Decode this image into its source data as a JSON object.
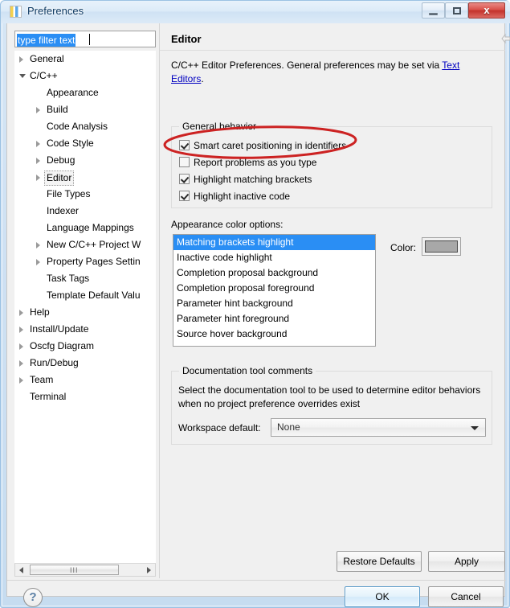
{
  "window": {
    "title": "Preferences",
    "icon": "preferences-icon",
    "buttons": {
      "minimize": "minimize-icon",
      "maximize": "maximize-icon",
      "close": "x"
    }
  },
  "filter": {
    "value": "type filter text",
    "placeholder": "type filter text"
  },
  "tree": {
    "items": [
      {
        "label": "General",
        "level": 1,
        "arrow": "collapsed",
        "focused": false
      },
      {
        "label": "C/C++",
        "level": 1,
        "arrow": "expanded",
        "focused": false
      },
      {
        "label": "Appearance",
        "level": 2,
        "arrow": "none",
        "focused": false
      },
      {
        "label": "Build",
        "level": 2,
        "arrow": "collapsed",
        "focused": false
      },
      {
        "label": "Code Analysis",
        "level": 2,
        "arrow": "none",
        "focused": false
      },
      {
        "label": "Code Style",
        "level": 2,
        "arrow": "collapsed",
        "focused": false
      },
      {
        "label": "Debug",
        "level": 2,
        "arrow": "collapsed",
        "focused": false
      },
      {
        "label": "Editor",
        "level": 2,
        "arrow": "collapsed",
        "focused": true
      },
      {
        "label": "File Types",
        "level": 2,
        "arrow": "none",
        "focused": false
      },
      {
        "label": "Indexer",
        "level": 2,
        "arrow": "none",
        "focused": false
      },
      {
        "label": "Language Mappings",
        "level": 2,
        "arrow": "none",
        "focused": false
      },
      {
        "label": "New C/C++ Project W",
        "level": 2,
        "arrow": "collapsed",
        "focused": false
      },
      {
        "label": "Property Pages Settin",
        "level": 2,
        "arrow": "collapsed",
        "focused": false
      },
      {
        "label": "Task Tags",
        "level": 2,
        "arrow": "none",
        "focused": false
      },
      {
        "label": "Template Default Valu",
        "level": 2,
        "arrow": "none",
        "focused": false
      },
      {
        "label": "Help",
        "level": 1,
        "arrow": "collapsed",
        "focused": false
      },
      {
        "label": "Install/Update",
        "level": 1,
        "arrow": "collapsed",
        "focused": false
      },
      {
        "label": "Oscfg Diagram",
        "level": 1,
        "arrow": "collapsed",
        "focused": false
      },
      {
        "label": "Run/Debug",
        "level": 1,
        "arrow": "collapsed",
        "focused": false
      },
      {
        "label": "Team",
        "level": 1,
        "arrow": "collapsed",
        "focused": false
      },
      {
        "label": "Terminal",
        "level": 1,
        "arrow": "none",
        "focused": false
      }
    ],
    "scrollbar_grip": "III"
  },
  "page": {
    "title": "Editor",
    "description_prefix": "C/C++ Editor Preferences. General preferences may be set via ",
    "description_link": "Text Editors",
    "description_suffix": ".",
    "nav": {
      "back": "back-arrow-icon",
      "back_menu": "chevron-down-icon",
      "forward": "forward-arrow-icon",
      "forward_menu": "chevron-down-icon",
      "more": "chevron-down-icon"
    }
  },
  "general_behavior": {
    "title": "General behavior",
    "checkboxes": [
      {
        "label": "Smart caret positioning in identifiers",
        "checked": true
      },
      {
        "label": "Report problems as you type",
        "checked": false
      },
      {
        "label": "Highlight matching brackets",
        "checked": true
      },
      {
        "label": "Highlight inactive code",
        "checked": true
      }
    ]
  },
  "appearance": {
    "label": "Appearance color options:",
    "options": [
      "Matching brackets highlight",
      "Inactive code highlight",
      "Completion proposal background",
      "Completion proposal foreground",
      "Parameter hint background",
      "Parameter hint foreground",
      "Source hover background"
    ],
    "selected_index": 0,
    "color_label": "Color:",
    "color_value": "#a8a8a8"
  },
  "documentation": {
    "title": "Documentation tool comments",
    "description": "Select the documentation tool to be used to determine editor behaviors when no project preference overrides exist",
    "workspace_label": "Workspace default:",
    "workspace_value": "None"
  },
  "footer": {
    "restore_defaults": "Restore Defaults",
    "apply": "Apply",
    "help": "?",
    "ok": "OK",
    "cancel": "Cancel"
  },
  "annotation": {
    "shape": "ellipse",
    "color": "#cc2222",
    "targets": "Report problems as you type"
  }
}
